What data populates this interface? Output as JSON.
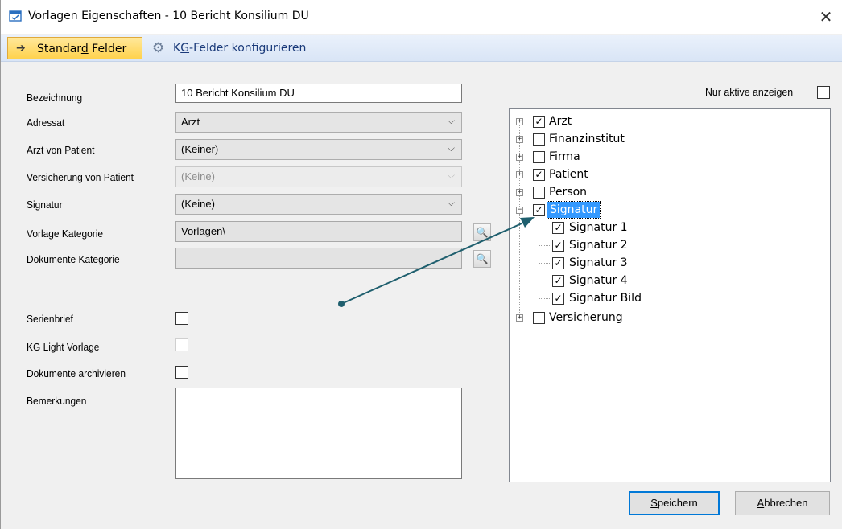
{
  "window": {
    "title": "Vorlagen Eigenschaften - 10 Bericht Konsilium DU",
    "close_glyph": "✕"
  },
  "toolbar": {
    "tab_standard": {
      "pre": "Standar",
      "accel": "d",
      "post": " Felder",
      "icon": "arrow-right-icon"
    },
    "tab_kg": {
      "pre": "K",
      "accel": "G",
      "post": "-Felder konfigurieren",
      "icon": "gear-icon"
    }
  },
  "form": {
    "bezeichnung": {
      "label": "Bezeichnung",
      "value": "10 Bericht Konsilium DU"
    },
    "adressat": {
      "label": "Adressat",
      "value": "Arzt"
    },
    "arzt_von_patient": {
      "label": "Arzt von Patient",
      "value": "(Keiner)"
    },
    "versicherung_von_patient": {
      "label": "Versicherung von Patient",
      "value": "(Keine)"
    },
    "signatur": {
      "label": "Signatur",
      "value": "(Keine)"
    },
    "vorlage_kategorie": {
      "label": "Vorlage Kategorie",
      "value": "Vorlagen\\"
    },
    "dokumente_kategorie": {
      "label": "Dokumente Kategorie",
      "value": ""
    },
    "serienbrief": {
      "label": "Serienbrief",
      "checked": false
    },
    "kg_light_vorlage": {
      "label": "KG Light Vorlage",
      "checked": false,
      "disabled": true
    },
    "dokumente_archivieren": {
      "label": "Dokumente archivieren",
      "checked": false
    },
    "bemerkungen": {
      "label": "Bemerkungen",
      "value": ""
    }
  },
  "nur_aktive": {
    "label": "Nur aktive anzeigen",
    "checked": false
  },
  "tree": {
    "nodes": [
      {
        "label": "Arzt",
        "checked": true,
        "expander": "+"
      },
      {
        "label": "Finanzinstitut",
        "checked": false,
        "expander": "+"
      },
      {
        "label": "Firma",
        "checked": false,
        "expander": "+"
      },
      {
        "label": "Patient",
        "checked": true,
        "expander": "+"
      },
      {
        "label": "Person",
        "checked": false,
        "expander": "+"
      },
      {
        "label": "Signatur",
        "checked": true,
        "expander": "−",
        "selected": true
      },
      {
        "label": "Signatur 1",
        "checked": true,
        "child": true
      },
      {
        "label": "Signatur 2",
        "checked": true,
        "child": true
      },
      {
        "label": "Signatur 3",
        "checked": true,
        "child": true
      },
      {
        "label": "Signatur 4",
        "checked": true,
        "child": true
      },
      {
        "label": "Signatur Bild",
        "checked": true,
        "child": true
      },
      {
        "label": "Versicherung",
        "checked": false,
        "expander": "+"
      }
    ]
  },
  "buttons": {
    "speichern": {
      "accel": "S",
      "rest": "peichern"
    },
    "abbrechen": {
      "accel": "A",
      "rest": "bbrechen"
    }
  },
  "check_glyph": "✓",
  "browse_icon": "search-icon",
  "chevron_icon": "chevron-down-icon",
  "colors": {
    "annotation": "#1f5f6e",
    "selection": "#3399ff",
    "toolbar_active": "#ffd24d"
  }
}
